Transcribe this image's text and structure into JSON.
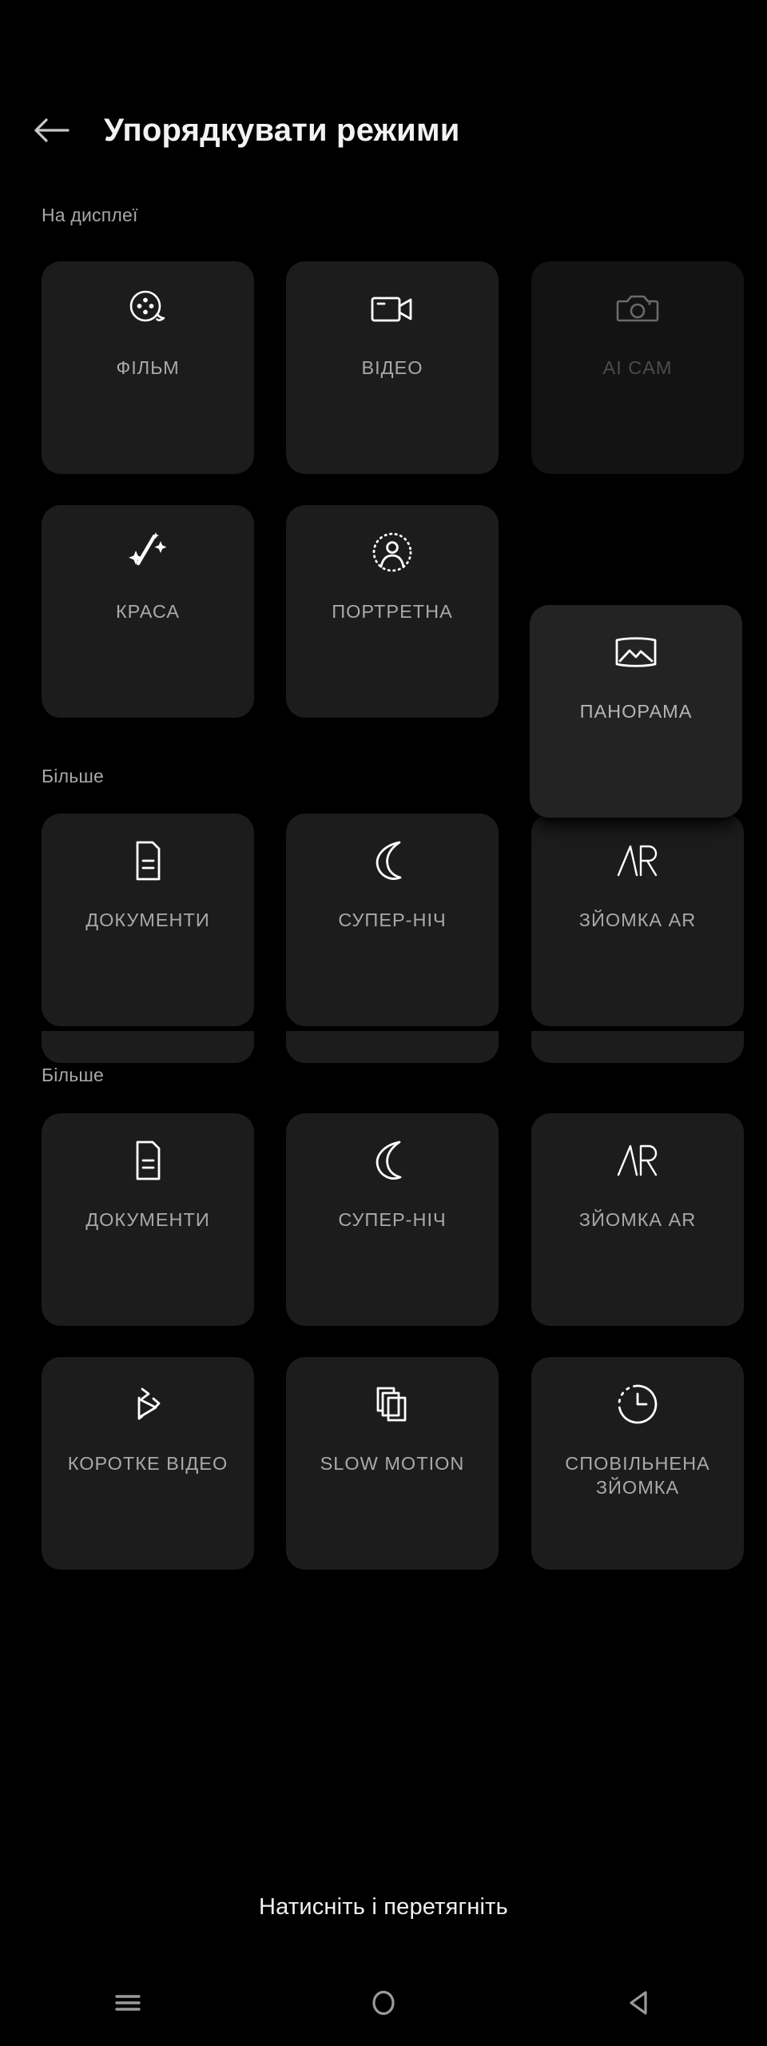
{
  "appbar": {
    "back_icon": "arrow-left-icon",
    "title": "Упорядкувати режими"
  },
  "sections": [
    {
      "label": "На дисплеї"
    },
    {
      "label": "Більше"
    },
    {
      "label": "Більше"
    }
  ],
  "tiles": {
    "film": {
      "label": "ФІЛЬМ",
      "icon": "film-reel-icon"
    },
    "video": {
      "label": "ВІДЕО",
      "icon": "video-camera-icon"
    },
    "aicam": {
      "label": "AI CAM",
      "icon": "camera-icon"
    },
    "beauty": {
      "label": "КРАСА",
      "icon": "magic-wand-sparkle-icon"
    },
    "portrait": {
      "label": "ПОРТРЕТНА",
      "icon": "person-portrait-icon"
    },
    "panorama": {
      "label": "ПАНОРАМА",
      "icon": "panorama-mountain-icon"
    },
    "documents1": {
      "label": "ДОКУМЕНТИ",
      "icon": "document-icon"
    },
    "supernight1": {
      "label": "СУПЕР-НІЧ",
      "icon": "moon-icon"
    },
    "arshot1": {
      "label": "ЗЙОМКА AR",
      "icon": "ar-icon"
    },
    "documents2": {
      "label": "ДОКУМЕНТИ",
      "icon": "document-icon"
    },
    "supernight2": {
      "label": "СУПЕР-НІЧ",
      "icon": "moon-icon"
    },
    "arshot2": {
      "label": "ЗЙОМКА AR",
      "icon": "ar-icon"
    },
    "shortvideo": {
      "label": "КОРОТКЕ ВІДЕО",
      "icon": "short-video-icon"
    },
    "slowmotion": {
      "label": "SLOW MOTION",
      "icon": "layers-copy-icon"
    },
    "timelapse": {
      "label": "СПОВІЛЬНЕНА ЗЙОМКА",
      "icon": "clock-timelapse-icon"
    }
  },
  "hint": {
    "text": "Натисніть і перетягніть"
  },
  "navbar": {
    "recents_icon": "menu-lines-icon",
    "home_icon": "circle-icon",
    "back_icon": "triangle-back-icon"
  },
  "colors": {
    "background": "#000000",
    "tile": "#1c1c1c",
    "tile_dim": "#131313",
    "tile_floating": "#232323",
    "label": "#a9a9a9",
    "label_dim": "#4c4c4c",
    "title": "#f2f2f2",
    "section_label": "#a8a8a8",
    "icon": "#ffffff",
    "icon_dim": "#6a6a6a"
  }
}
